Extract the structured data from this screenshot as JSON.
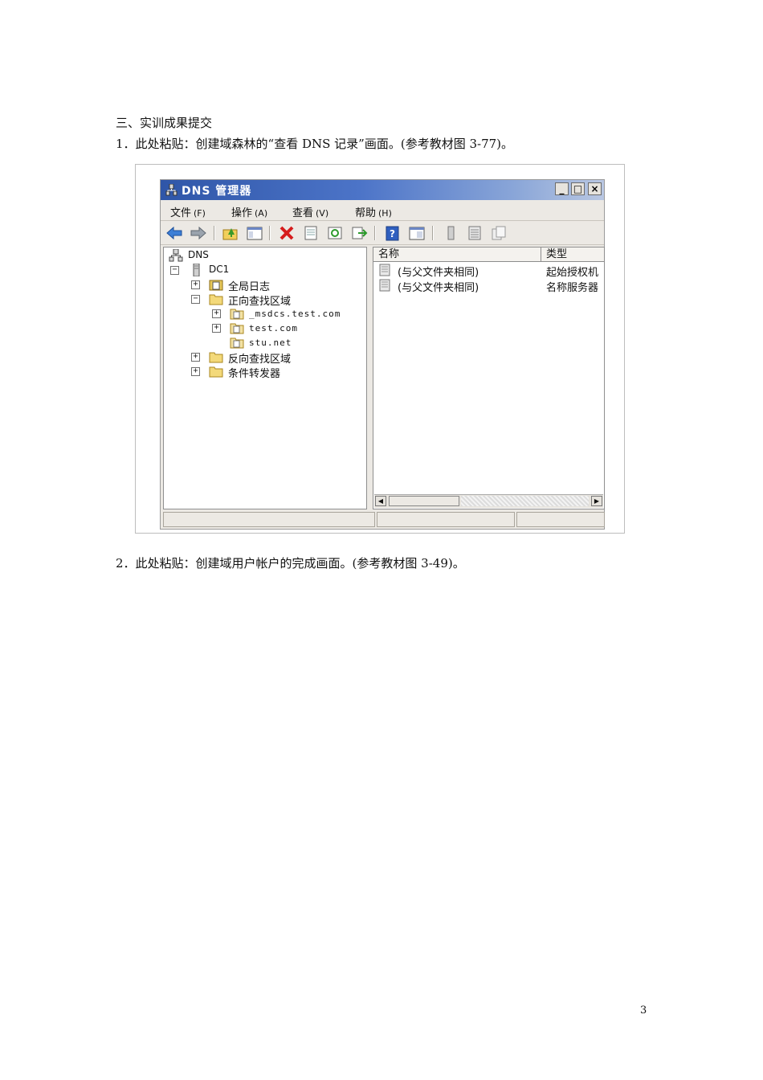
{
  "document": {
    "section_heading": "三、实训成果提交",
    "item1": "1．此处粘贴：创建域森林的“查看 DNS 记录”画面。(参考教材图 3-77)。",
    "item2": "2．此处粘贴：创建域用户帐户的完成画面。(参考教材图 3-49)。",
    "page_number": "3"
  },
  "window": {
    "title": "DNS 管理器",
    "controls": {
      "minimize": "_",
      "maximize": "□",
      "close": "×"
    }
  },
  "menu": [
    {
      "label": "文件",
      "accel": "(F)"
    },
    {
      "label": "操作",
      "accel": "(A)"
    },
    {
      "label": "查看",
      "accel": "(V)"
    },
    {
      "label": "帮助",
      "accel": "(H)"
    }
  ],
  "toolbar": {
    "icons": [
      "back-arrow-icon",
      "forward-arrow-icon",
      "up-folder-icon",
      "show-hide-tree-icon",
      "delete-icon",
      "properties-icon",
      "refresh-icon",
      "export-list-icon",
      "help-icon",
      "console-icon",
      "server-icon",
      "list-icon",
      "copy-icon"
    ]
  },
  "tree": {
    "root": "DNS",
    "server": "DC1",
    "global_log": "全局日志",
    "forward_zones": "正向查找区域",
    "zone_msdcs": "_msdcs.test.com",
    "zone_test": "test.com",
    "zone_stu": "stu.net",
    "reverse_zones": "反向查找区域",
    "conditional_forwarders": "条件转发器"
  },
  "list": {
    "columns": [
      "名称",
      "类型"
    ],
    "rows": [
      {
        "name": "(与父文件夹相同)",
        "type": "起始授权机"
      },
      {
        "name": "(与父文件夹相同)",
        "type": "名称服务器"
      }
    ]
  },
  "colors": {
    "titlebar": "#2f56a8",
    "window_bg": "#ece9e4"
  }
}
